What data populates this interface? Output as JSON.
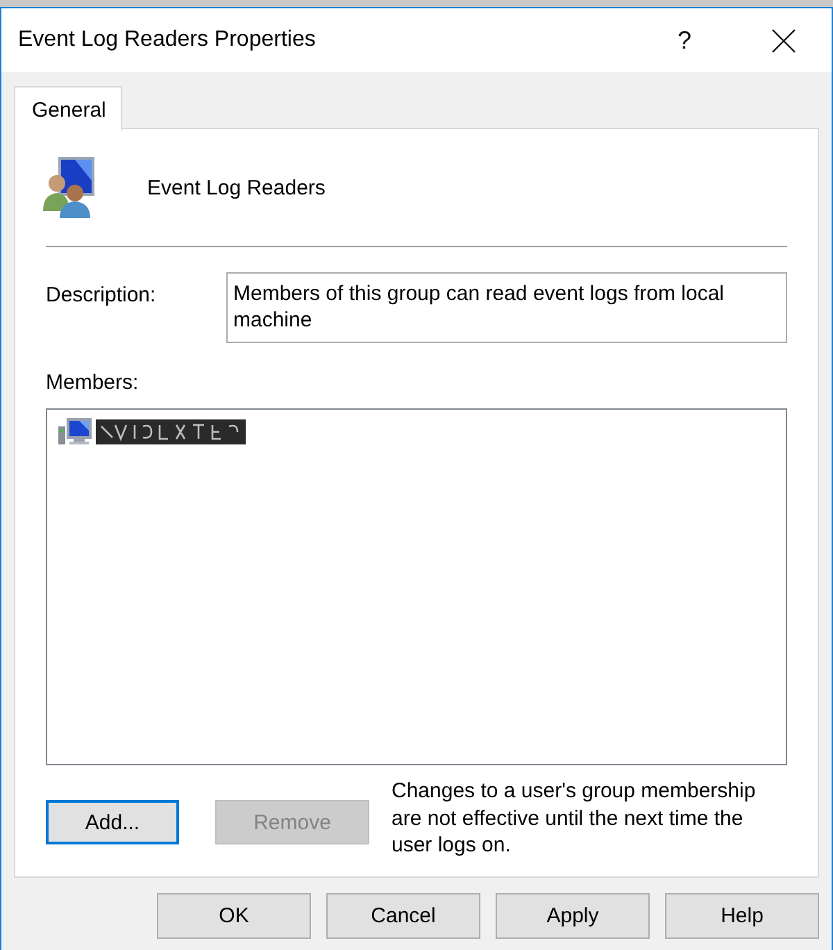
{
  "window": {
    "title": "Event Log Readers Properties",
    "help_button": "?"
  },
  "tabs": [
    {
      "label": "General",
      "selected": true
    }
  ],
  "group": {
    "name": "Event Log Readers"
  },
  "description": {
    "label": "Description:",
    "value": "Members of this group can read event logs from local machine"
  },
  "members": {
    "label": "Members:",
    "items": [
      {
        "redacted": true
      }
    ]
  },
  "member_buttons": [
    {
      "label": "Add...",
      "focused": true,
      "disabled": false
    },
    {
      "label": "Remove",
      "focused": false,
      "disabled": true
    }
  ],
  "note": "Changes to a user's group membership are not effective until the next time the user logs on.",
  "dialog_buttons": [
    {
      "label": "OK"
    },
    {
      "label": "Cancel"
    },
    {
      "label": "Apply"
    },
    {
      "label": "Help"
    }
  ]
}
